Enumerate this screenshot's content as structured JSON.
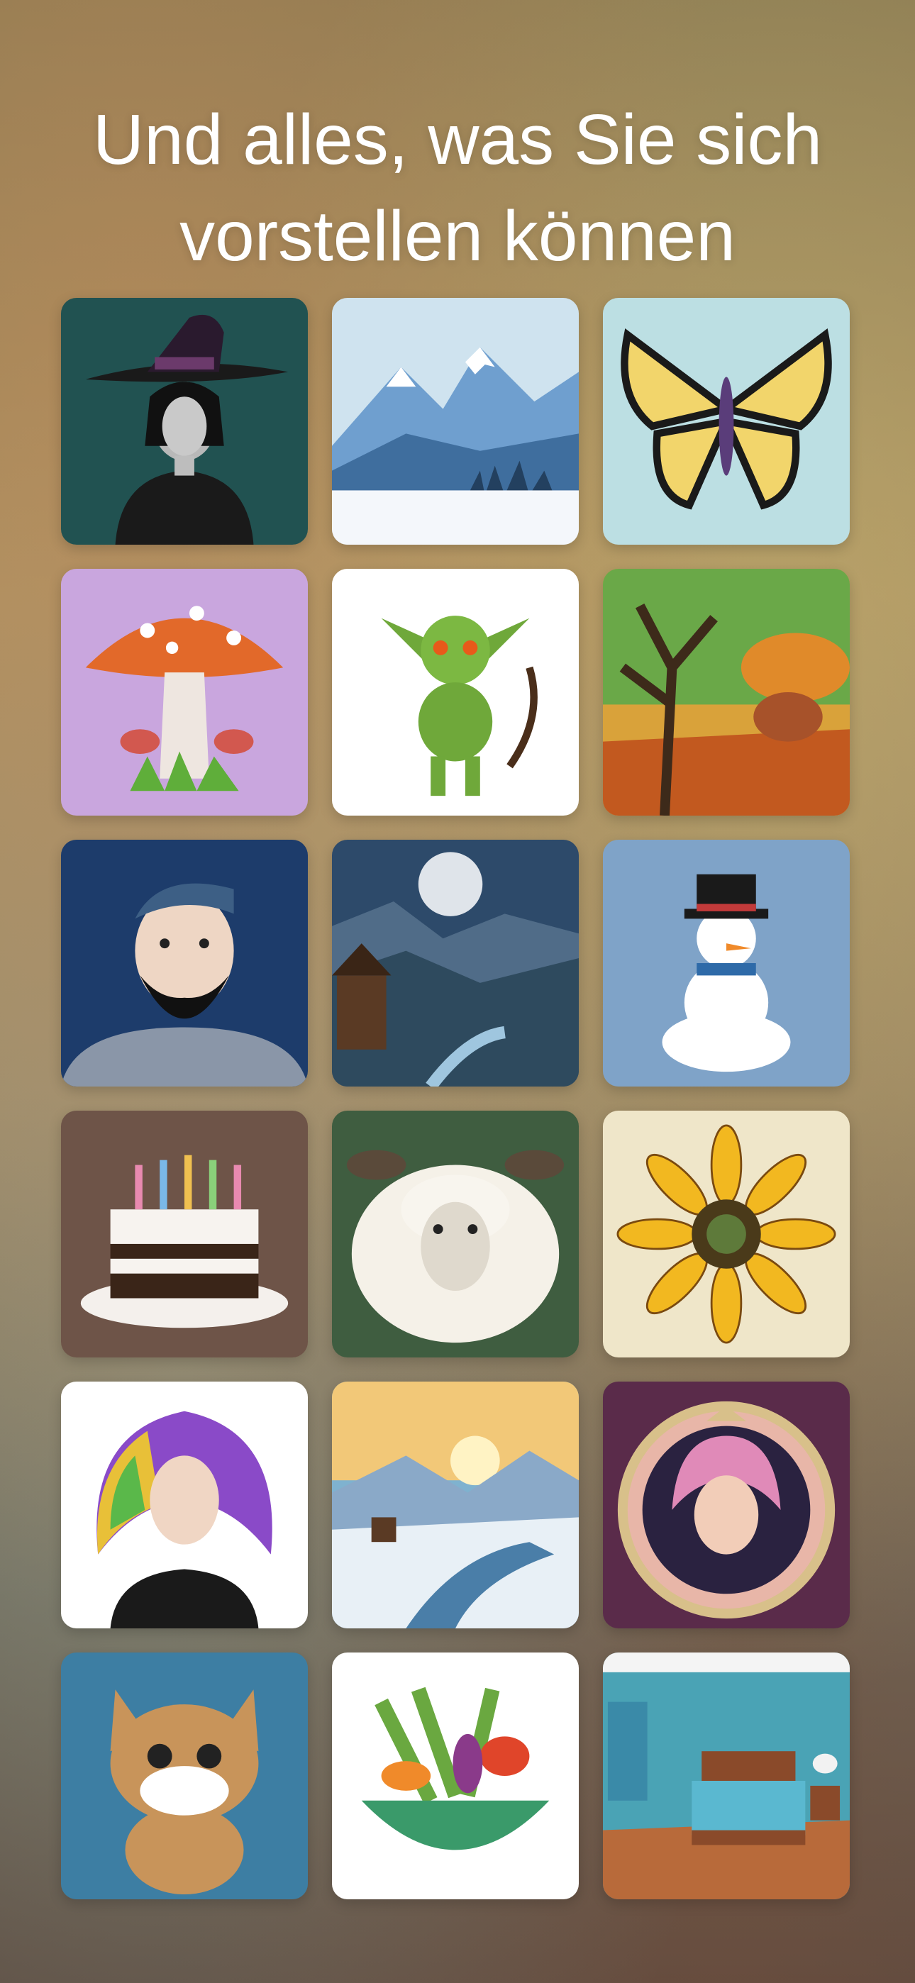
{
  "headline": {
    "line1": "Und alles, was Sie sich",
    "line2": "vorstellen können"
  },
  "tiles": [
    {
      "subject": "witch-illustration",
      "bg": "#215251"
    },
    {
      "subject": "snowy-mountains-illustration",
      "bg": "#cfe3ef"
    },
    {
      "subject": "butterfly-illustration",
      "bg": "#bcdfe3"
    },
    {
      "subject": "mushroom-illustration",
      "bg": "#c9a6de"
    },
    {
      "subject": "goblin-illustration",
      "bg": "#ffffff"
    },
    {
      "subject": "autumn-tree-illustration",
      "bg": "#d9a23a"
    },
    {
      "subject": "bearded-man-illustration",
      "bg": "#1d3c6b"
    },
    {
      "subject": "moonlit-valley-illustration",
      "bg": "#3d5e7a"
    },
    {
      "subject": "snowman-illustration",
      "bg": "#7fa3c8"
    },
    {
      "subject": "birthday-cake-illustration",
      "bg": "#6e5448"
    },
    {
      "subject": "sheep-illustration",
      "bg": "#3f5d40"
    },
    {
      "subject": "sunflower-illustration",
      "bg": "#efe6c9"
    },
    {
      "subject": "rainbow-hair-woman-illustration",
      "bg": "#ffffff"
    },
    {
      "subject": "winter-river-illustration",
      "bg": "#7fb2cf"
    },
    {
      "subject": "art-deco-woman-illustration",
      "bg": "#5a2b4a"
    },
    {
      "subject": "cat-illustration",
      "bg": "#3d7ea3"
    },
    {
      "subject": "vegetable-bowl-illustration",
      "bg": "#ffffff"
    },
    {
      "subject": "bedroom-illustration",
      "bg": "#4aa3b5"
    }
  ]
}
